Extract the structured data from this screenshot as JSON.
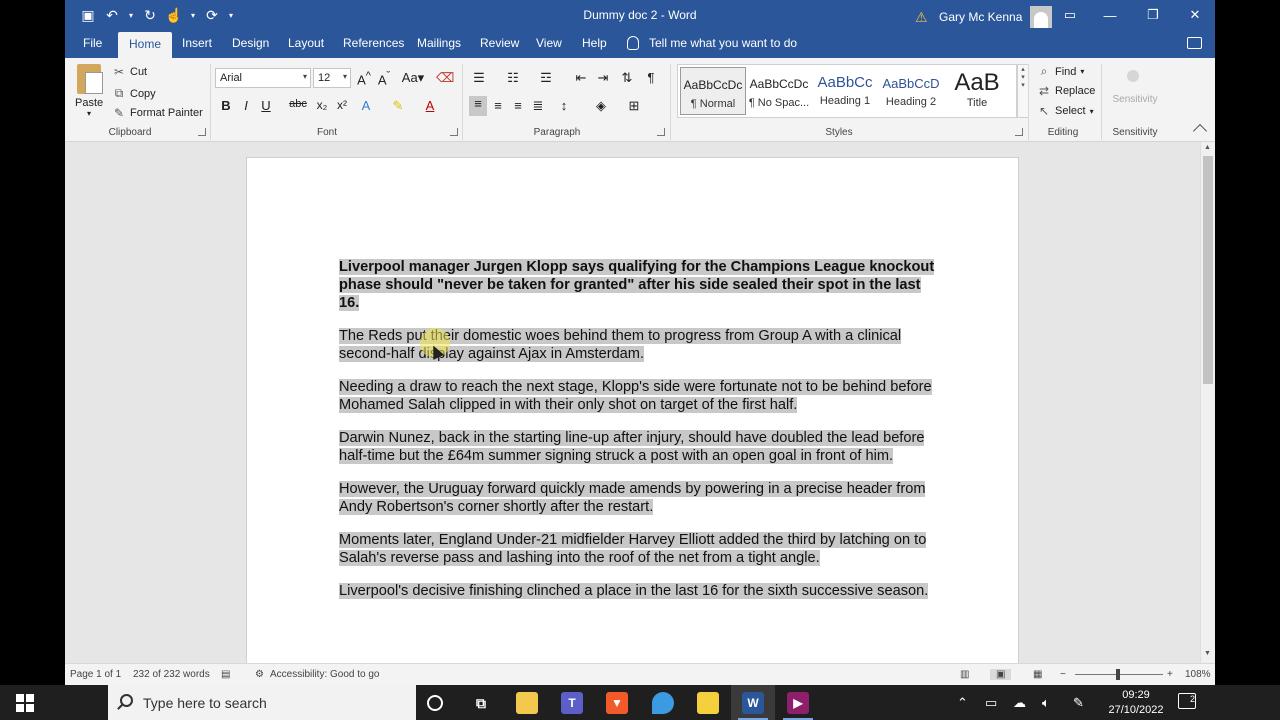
{
  "window": {
    "title": "Dummy doc 2 - Word",
    "user_name": "Gary Mc Kenna"
  },
  "tabs": [
    "File",
    "Home",
    "Insert",
    "Design",
    "Layout",
    "References",
    "Mailings",
    "Review",
    "View",
    "Help"
  ],
  "active_tab": "Home",
  "tell_me": "Tell me what you want to do",
  "ribbon": {
    "clipboard": {
      "label": "Clipboard",
      "paste": "Paste",
      "cut": "Cut",
      "copy": "Copy",
      "format_painter": "Format Painter"
    },
    "font": {
      "label": "Font",
      "name": "Arial",
      "size": "12"
    },
    "paragraph": {
      "label": "Paragraph"
    },
    "styles": {
      "label": "Styles",
      "items": [
        {
          "sample": "AaBbCcDc",
          "name": "¶ Normal"
        },
        {
          "sample": "AaBbCcDc",
          "name": "¶ No Spac..."
        },
        {
          "sample": "AaBbCc",
          "name": "Heading 1"
        },
        {
          "sample": "AaBbCcD",
          "name": "Heading 2"
        },
        {
          "sample": "AaB",
          "name": "Title"
        }
      ]
    },
    "editing": {
      "label": "Editing",
      "find": "Find",
      "replace": "Replace",
      "select": "Select"
    },
    "sensitivity": {
      "label": "Sensitivity",
      "button": "Sensitivity"
    }
  },
  "document": {
    "paragraphs": [
      "Liverpool manager Jurgen Klopp says qualifying for the Champions League knockout phase should \"never be taken for granted\" after his side sealed their spot in the last 16.",
      "The Reds put their domestic woes behind them to progress from Group A with a clinical second-half display against Ajax in Amsterdam.",
      "Needing a draw to reach the next stage, Klopp's side were fortunate not to be behind before Mohamed Salah clipped in with their only shot on target of the first half.",
      "Darwin Nunez, back in the starting line-up after injury, should have doubled the lead before half-time but the £64m summer signing struck a post with an open goal in front of him.",
      "However, the Uruguay forward quickly made amends by powering in a precise header from Andy Robertson's corner shortly after the restart.",
      "Moments later, England Under-21 midfielder Harvey Elliott added the third by latching on to Salah's reverse pass and lashing into the roof of the net from a tight angle.",
      "Liverpool's decisive finishing clinched a place in the last 16 for the sixth successive season."
    ]
  },
  "status": {
    "page": "Page 1 of 1",
    "words": "232 of 232 words",
    "accessibility": "Accessibility: Good to go",
    "zoom": "108%"
  },
  "taskbar": {
    "search_placeholder": "Type here to search",
    "time": "09:29",
    "date": "27/10/2022",
    "notifications": "2"
  }
}
